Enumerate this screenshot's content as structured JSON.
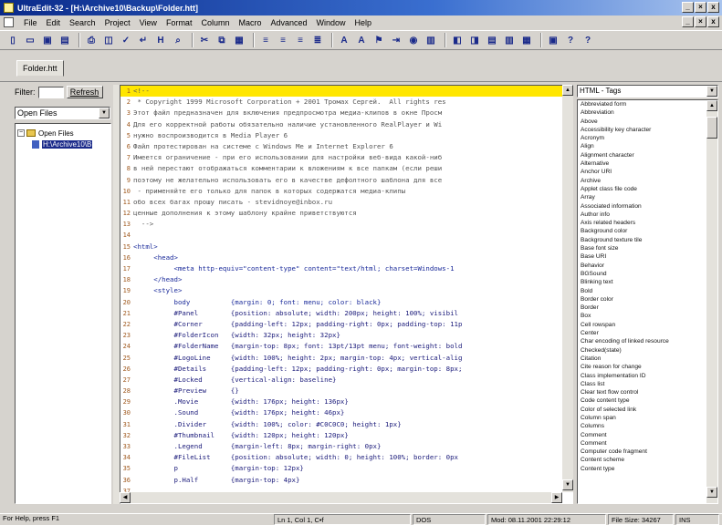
{
  "window": {
    "title": "UltraEdit-32 - [H:\\Archive10\\Backup\\Folder.htt]",
    "minimize": "_",
    "maximize": "×",
    "close": "x"
  },
  "menu": [
    "File",
    "Edit",
    "Search",
    "Project",
    "View",
    "Format",
    "Column",
    "Macro",
    "Advanced",
    "Window",
    "Help"
  ],
  "toolbar": {
    "icons": [
      "new-file-icon",
      "open-file-icon",
      "save-icon",
      "save-all-icon",
      "print-icon",
      "print-preview-icon",
      "spell-check-icon",
      "wrap-icon",
      "hex-icon",
      "find-icon",
      "cut-icon",
      "copy-icon",
      "paste-icon",
      "align-left-icon",
      "align-center-icon",
      "align-right-icon",
      "justify-icon",
      "find-in-files-icon",
      "replace-icon",
      "bookmark-icon",
      "goto-icon",
      "macro-icon",
      "window-tile-icon",
      "window-cascade-icon",
      "file-tree-icon",
      "output-icon",
      "tag-list-icon",
      "options-icon",
      "help-icon",
      "context-help-icon"
    ]
  },
  "tabs": [
    {
      "label": "Folder.htt"
    }
  ],
  "file_tree": {
    "filter_label": "Filter:",
    "filter_value": "",
    "refresh_label": "Refresh",
    "view_select": "Open Files",
    "nodes": [
      {
        "label": "Open Files",
        "expander": "−"
      },
      {
        "label": "H:\\Archive10\\B"
      }
    ]
  },
  "editor": {
    "lines": [
      {
        "n": "1",
        "text": "<!--",
        "hl": true
      },
      {
        "n": "2",
        "text": " * Copyright 1999 Microsoft Corporation + 2001 Тромах Сергей.  All rights res"
      },
      {
        "n": "3",
        "text": "Этот файл предназначен для включения предпросмотра медиа-клипов в окне Просм"
      },
      {
        "n": "4",
        "text": "Для его корректной работы обязательно наличие установленного RealPlayer и Wi"
      },
      {
        "n": "5",
        "text": "нужно воспроизводится в Media Player 6"
      },
      {
        "n": "6",
        "text": "Файл протестирован на системе с Windows Me и Internet Explorer 6"
      },
      {
        "n": "7",
        "text": "Имеется ограничение - при его использовании для настройки веб-вида какой-ниб"
      },
      {
        "n": "8",
        "text": "в ней перестают отображаться комментарии к вложениям к все папкам (если реши"
      },
      {
        "n": "9",
        "text": "поэтому не желательно использовать его в качестве дефолтного шаблона для все"
      },
      {
        "n": "10",
        "text": " - применяйте его только для папок в которых содержатся медиа-клипы"
      },
      {
        "n": "11",
        "text": "обо всех багах прошу писать - stevidnoye@inbox.ru"
      },
      {
        "n": "12",
        "text": "ценные дополнения к этому шаблону крайне приветствуются"
      },
      {
        "n": "13",
        "text": "  -->"
      },
      {
        "n": "14",
        "text": ""
      },
      {
        "n": "15",
        "text": "<html>"
      },
      {
        "n": "16",
        "text": "     <head>"
      },
      {
        "n": "17",
        "text": "          <meta http-equiv=\"content-type\" content=\"text/html; charset=Windows-1"
      },
      {
        "n": "18",
        "text": "     </head>"
      },
      {
        "n": "19",
        "text": "     <style>"
      },
      {
        "n": "20",
        "text": "          body          {margin: 0; font: menu; color: black}"
      },
      {
        "n": "21",
        "text": "          #Panel        {position: absolute; width: 200px; height: 100%; visibil"
      },
      {
        "n": "22",
        "text": "          #Corner       {padding-left: 12px; padding-right: 0px; padding-top: 11p"
      },
      {
        "n": "23",
        "text": "          #FolderIcon   {width: 32px; height: 32px}"
      },
      {
        "n": "24",
        "text": "          #FolderName   {margin-top: 8px; font: 13pt/13pt menu; font-weight: bold"
      },
      {
        "n": "25",
        "text": "          #LogoLine     {width: 100%; height: 2px; margin-top: 4px; vertical-alig"
      },
      {
        "n": "26",
        "text": "          #Details      {padding-left: 12px; padding-right: 0px; margin-top: 8px;"
      },
      {
        "n": "27",
        "text": "          #Locked       {vertical-align: baseline}"
      },
      {
        "n": "28",
        "text": "          #Preview      {}"
      },
      {
        "n": "29",
        "text": "          .Movie        {width: 176px; height: 136px}"
      },
      {
        "n": "30",
        "text": "          .Sound        {width: 176px; height: 46px}"
      },
      {
        "n": "31",
        "text": "          .Divider      {width: 100%; color: #C0C0C0; height: 1px}"
      },
      {
        "n": "32",
        "text": "          #Thumbnail    {width: 120px; height: 120px}"
      },
      {
        "n": "33",
        "text": "          .Legend       {margin-left: 8px; margin-right: 0px}"
      },
      {
        "n": "34",
        "text": "          #FileList     {position: absolute; width: 0; height: 100%; border: 0px"
      },
      {
        "n": "35",
        "text": "          p             {margin-top: 12px}"
      },
      {
        "n": "36",
        "text": "          p.Half        {margin-top: 4px}"
      },
      {
        "n": "37",
        "text": ""
      }
    ]
  },
  "tag_panel": {
    "select": "HTML - Tags",
    "items": [
      "Abbreviated form",
      "Abbreviation",
      "Above",
      "Accessibility key character",
      "Acronym",
      "Align",
      "Alignment character",
      "Alternative",
      "Anchor URI",
      "Archive",
      "Applet class file code",
      "Array",
      "Associated information",
      "Author info",
      "Axis related headers",
      "Background color",
      "Background texture tile",
      "Base font size",
      "Base URI",
      "Behavior",
      "BGSound",
      "Blinking text",
      "Bold",
      "Border color",
      "Border",
      "Box",
      "Cell rowspan",
      "Center",
      "Char encoding of linked resource",
      "Checked(state)",
      "Citation",
      "Cite reason for change",
      "Class implementation ID",
      "Class list",
      "Clear text flow control",
      "Code content type",
      "Color of selected link",
      "Column span",
      "Columns",
      "Comment",
      "Comment",
      "Computer code fragment",
      "Content scheme",
      "Content type"
    ]
  },
  "status": {
    "help": "For Help, press F1",
    "position": "Ln 1, Col 1, C•f",
    "format": "DOS",
    "modified": "Mod: 08.11.2001 22:29:12",
    "filesize": "File Size: 34267",
    "mode": "INS"
  }
}
